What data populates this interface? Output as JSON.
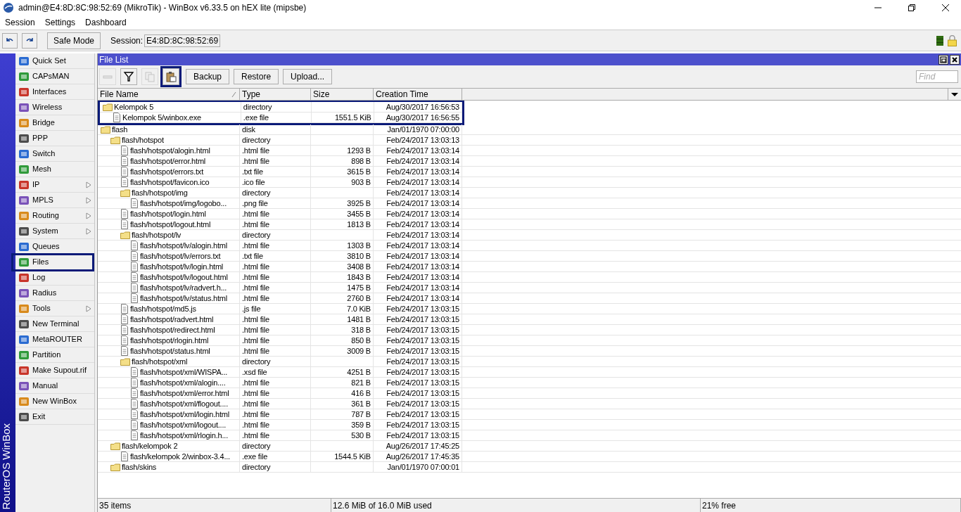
{
  "window": {
    "title": "admin@E4:8D:8C:98:52:69 (MikroTik) - WinBox v6.33.5 on hEX lite (mipsbe)"
  },
  "menu": [
    "Session",
    "Settings",
    "Dashboard"
  ],
  "toolbar": {
    "safe_mode": "Safe Mode",
    "session_label": "Session:",
    "session_value": "E4:8D:8C:98:52:69"
  },
  "side_brand": "RouterOS WinBox",
  "sidebar": {
    "items": [
      {
        "label": "Quick Set",
        "has_submenu": false,
        "highlighted": false
      },
      {
        "label": "CAPsMAN",
        "has_submenu": false,
        "highlighted": false
      },
      {
        "label": "Interfaces",
        "has_submenu": false,
        "highlighted": false
      },
      {
        "label": "Wireless",
        "has_submenu": false,
        "highlighted": false
      },
      {
        "label": "Bridge",
        "has_submenu": false,
        "highlighted": false
      },
      {
        "label": "PPP",
        "has_submenu": false,
        "highlighted": false
      },
      {
        "label": "Switch",
        "has_submenu": false,
        "highlighted": false
      },
      {
        "label": "Mesh",
        "has_submenu": false,
        "highlighted": false
      },
      {
        "label": "IP",
        "has_submenu": true,
        "highlighted": false
      },
      {
        "label": "MPLS",
        "has_submenu": true,
        "highlighted": false
      },
      {
        "label": "Routing",
        "has_submenu": true,
        "highlighted": false
      },
      {
        "label": "System",
        "has_submenu": true,
        "highlighted": false
      },
      {
        "label": "Queues",
        "has_submenu": false,
        "highlighted": false
      },
      {
        "label": "Files",
        "has_submenu": false,
        "highlighted": true
      },
      {
        "label": "Log",
        "has_submenu": false,
        "highlighted": false
      },
      {
        "label": "Radius",
        "has_submenu": false,
        "highlighted": false
      },
      {
        "label": "Tools",
        "has_submenu": true,
        "highlighted": false
      },
      {
        "label": "New Terminal",
        "has_submenu": false,
        "highlighted": false
      },
      {
        "label": "MetaROUTER",
        "has_submenu": false,
        "highlighted": false
      },
      {
        "label": "Partition",
        "has_submenu": false,
        "highlighted": false
      },
      {
        "label": "Make Supout.rif",
        "has_submenu": false,
        "highlighted": false
      },
      {
        "label": "Manual",
        "has_submenu": false,
        "highlighted": false
      },
      {
        "label": "New WinBox",
        "has_submenu": false,
        "highlighted": false
      },
      {
        "label": "Exit",
        "has_submenu": false,
        "highlighted": false
      }
    ]
  },
  "file_list": {
    "title": "File List",
    "tools": [
      {
        "kind": "remove",
        "disabled": true,
        "highlighted": false
      },
      {
        "kind": "filter",
        "disabled": false,
        "highlighted": false
      },
      {
        "kind": "copy",
        "disabled": true,
        "highlighted": false
      },
      {
        "kind": "paste",
        "disabled": false,
        "highlighted": true
      }
    ],
    "buttons": [
      "Backup",
      "Restore",
      "Upload..."
    ],
    "search": {
      "placeholder": "Find"
    },
    "columns": [
      "File Name",
      "Type",
      "Size",
      "Creation Time"
    ],
    "rows": [
      {
        "kind": "folder",
        "name": "Kelompok 5",
        "type": "directory",
        "time": "Aug/30/2017 16:56:53",
        "highlighted": true,
        "children": [
          {
            "kind": "file",
            "name": "Kelompok 5/winbox.exe",
            "type": ".exe file",
            "size": "1551.5 KiB",
            "time": "Aug/30/2017 16:56:55",
            "highlighted": false
          }
        ]
      },
      {
        "kind": "folder",
        "name": "flash",
        "type": "disk",
        "time": "Jan/01/1970 07:00:00",
        "highlighted": false,
        "children": [
          {
            "kind": "folder",
            "name": "flash/hotspot",
            "type": "directory",
            "time": "Feb/24/2017 13:03:13",
            "highlighted": false,
            "children": [
              {
                "kind": "file",
                "name": "flash/hotspot/alogin.html",
                "type": ".html file",
                "size": "1293 B",
                "time": "Feb/24/2017 13:03:14",
                "highlighted": false
              },
              {
                "kind": "file",
                "name": "flash/hotspot/error.html",
                "type": ".html file",
                "size": "898 B",
                "time": "Feb/24/2017 13:03:14",
                "highlighted": false
              },
              {
                "kind": "file",
                "name": "flash/hotspot/errors.txt",
                "type": ".txt file",
                "size": "3615 B",
                "time": "Feb/24/2017 13:03:14",
                "highlighted": false
              },
              {
                "kind": "file",
                "name": "flash/hotspot/favicon.ico",
                "type": ".ico file",
                "size": "903 B",
                "time": "Feb/24/2017 13:03:14",
                "highlighted": false
              },
              {
                "kind": "folder",
                "name": "flash/hotspot/img",
                "type": "directory",
                "time": "Feb/24/2017 13:03:14",
                "highlighted": false,
                "children": [
                  {
                    "kind": "file",
                    "name": "flash/hotspot/img/logobo...",
                    "type": ".png file",
                    "size": "3925 B",
                    "time": "Feb/24/2017 13:03:14",
                    "highlighted": false
                  }
                ]
              },
              {
                "kind": "file",
                "name": "flash/hotspot/login.html",
                "type": ".html file",
                "size": "3455 B",
                "time": "Feb/24/2017 13:03:14",
                "highlighted": false
              },
              {
                "kind": "file",
                "name": "flash/hotspot/logout.html",
                "type": ".html file",
                "size": "1813 B",
                "time": "Feb/24/2017 13:03:14",
                "highlighted": false
              },
              {
                "kind": "folder",
                "name": "flash/hotspot/lv",
                "type": "directory",
                "time": "Feb/24/2017 13:03:14",
                "highlighted": false,
                "children": [
                  {
                    "kind": "file",
                    "name": "flash/hotspot/lv/alogin.html",
                    "type": ".html file",
                    "size": "1303 B",
                    "time": "Feb/24/2017 13:03:14",
                    "highlighted": false
                  },
                  {
                    "kind": "file",
                    "name": "flash/hotspot/lv/errors.txt",
                    "type": ".txt file",
                    "size": "3810 B",
                    "time": "Feb/24/2017 13:03:14",
                    "highlighted": false
                  },
                  {
                    "kind": "file",
                    "name": "flash/hotspot/lv/login.html",
                    "type": ".html file",
                    "size": "3408 B",
                    "time": "Feb/24/2017 13:03:14",
                    "highlighted": false
                  },
                  {
                    "kind": "file",
                    "name": "flash/hotspot/lv/logout.html",
                    "type": ".html file",
                    "size": "1843 B",
                    "time": "Feb/24/2017 13:03:14",
                    "highlighted": false
                  },
                  {
                    "kind": "file",
                    "name": "flash/hotspot/lv/radvert.h...",
                    "type": ".html file",
                    "size": "1475 B",
                    "time": "Feb/24/2017 13:03:14",
                    "highlighted": false
                  },
                  {
                    "kind": "file",
                    "name": "flash/hotspot/lv/status.html",
                    "type": ".html file",
                    "size": "2760 B",
                    "time": "Feb/24/2017 13:03:14",
                    "highlighted": false
                  }
                ]
              },
              {
                "kind": "file",
                "name": "flash/hotspot/md5.js",
                "type": ".js file",
                "size": "7.0 KiB",
                "time": "Feb/24/2017 13:03:15",
                "highlighted": false
              },
              {
                "kind": "file",
                "name": "flash/hotspot/radvert.html",
                "type": ".html file",
                "size": "1481 B",
                "time": "Feb/24/2017 13:03:15",
                "highlighted": false
              },
              {
                "kind": "file",
                "name": "flash/hotspot/redirect.html",
                "type": ".html file",
                "size": "318 B",
                "time": "Feb/24/2017 13:03:15",
                "highlighted": false
              },
              {
                "kind": "file",
                "name": "flash/hotspot/rlogin.html",
                "type": ".html file",
                "size": "850 B",
                "time": "Feb/24/2017 13:03:15",
                "highlighted": false
              },
              {
                "kind": "file",
                "name": "flash/hotspot/status.html",
                "type": ".html file",
                "size": "3009 B",
                "time": "Feb/24/2017 13:03:15",
                "highlighted": false
              },
              {
                "kind": "folder",
                "name": "flash/hotspot/xml",
                "type": "directory",
                "time": "Feb/24/2017 13:03:15",
                "highlighted": false,
                "children": [
                  {
                    "kind": "file",
                    "name": "flash/hotspot/xml/WISPA...",
                    "type": ".xsd file",
                    "size": "4251 B",
                    "time": "Feb/24/2017 13:03:15",
                    "highlighted": false
                  },
                  {
                    "kind": "file",
                    "name": "flash/hotspot/xml/alogin....",
                    "type": ".html file",
                    "size": "821 B",
                    "time": "Feb/24/2017 13:03:15",
                    "highlighted": false
                  },
                  {
                    "kind": "file",
                    "name": "flash/hotspot/xml/error.html",
                    "type": ".html file",
                    "size": "416 B",
                    "time": "Feb/24/2017 13:03:15",
                    "highlighted": false
                  },
                  {
                    "kind": "file",
                    "name": "flash/hotspot/xml/flogout....",
                    "type": ".html file",
                    "size": "361 B",
                    "time": "Feb/24/2017 13:03:15",
                    "highlighted": false
                  },
                  {
                    "kind": "file",
                    "name": "flash/hotspot/xml/login.html",
                    "type": ".html file",
                    "size": "787 B",
                    "time": "Feb/24/2017 13:03:15",
                    "highlighted": false
                  },
                  {
                    "kind": "file",
                    "name": "flash/hotspot/xml/logout....",
                    "type": ".html file",
                    "size": "359 B",
                    "time": "Feb/24/2017 13:03:15",
                    "highlighted": false
                  },
                  {
                    "kind": "file",
                    "name": "flash/hotspot/xml/rlogin.h...",
                    "type": ".html file",
                    "size": "530 B",
                    "time": "Feb/24/2017 13:03:15",
                    "highlighted": false
                  }
                ]
              }
            ]
          },
          {
            "kind": "folder",
            "name": "flash/kelompok 2",
            "type": "directory",
            "time": "Aug/26/2017 17:45:25",
            "highlighted": false,
            "children": [
              {
                "kind": "file",
                "name": "flash/kelompok 2/winbox-3.4...",
                "type": ".exe file",
                "size": "1544.5 KiB",
                "time": "Aug/26/2017 17:45:35",
                "highlighted": false
              }
            ]
          },
          {
            "kind": "folder",
            "name": "flash/skins",
            "type": "directory",
            "time": "Jan/01/1970 07:00:01",
            "highlighted": false
          }
        ]
      }
    ]
  },
  "status_bar": [
    "35 items",
    "12.6 MiB of 16.0 MiB used",
    "21% free"
  ]
}
